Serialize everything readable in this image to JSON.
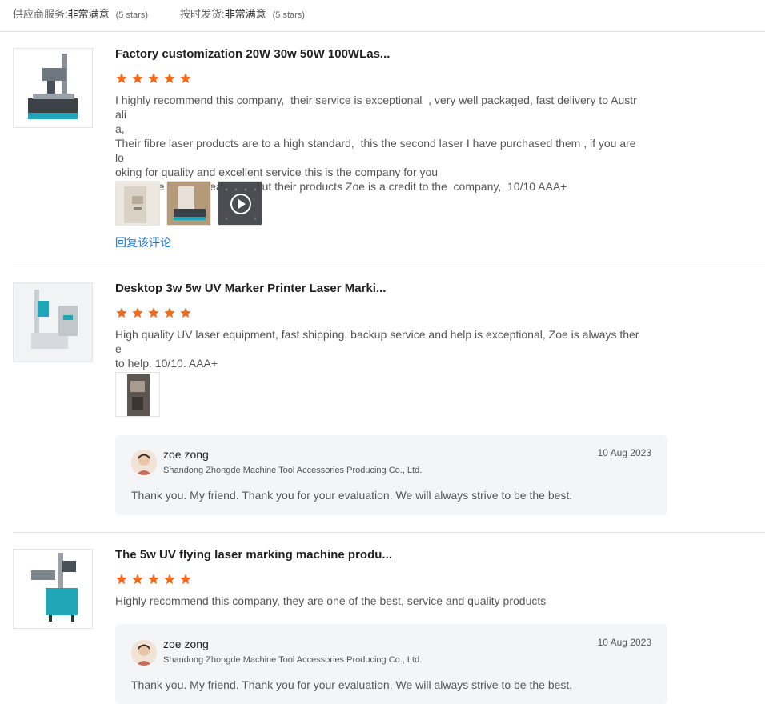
{
  "summary": {
    "supplier_service_label": "供应商服务:",
    "supplier_service_value": "非常满意",
    "supplier_service_stars": "(5 stars)",
    "delivery_label": "按时发货:",
    "delivery_value": "非常满意",
    "delivery_stars": "(5 stars)"
  },
  "colors": {
    "star": "#f56a1a",
    "link": "#1a73c9"
  },
  "reviews": [
    {
      "title": "Factory customization 20W 30w 50W 100WLas...",
      "rating": 5,
      "text": "I highly recommend this company,  their service is exceptional  , very well packaged, fast delivery to Australi\na,\nTheir fibre laser products are to a high standard,  this the second laser I have purchased them , if you are lo\noking for quality and excellent service this is the company for you\nZoe is the girl to speak to about their products Zoe is a credit to the  company,  10/10 AAA+",
      "media_icons": [
        "photo",
        "photo",
        "video-play-icon"
      ],
      "reply_link": "回复该评论"
    },
    {
      "title": "Desktop 3w 5w UV Marker Printer Laser Marki...",
      "rating": 5,
      "text": "High quality UV laser equipment, fast shipping. backup service and help is exceptional, Zoe is always there\nto help. 10/10. AAA+",
      "media_icons": [
        "photo"
      ],
      "supplier_reply": {
        "name": "zoe zong",
        "company": "Shandong Zhongde Machine Tool Accessories Producing Co., Ltd.",
        "date": "10 Aug 2023",
        "text": "Thank you. My friend. Thank you for your evaluation. We will always strive to be the best."
      }
    },
    {
      "title": "The 5w UV flying laser marking machine produ...",
      "rating": 5,
      "text": "Highly recommend this company, they are one of the best, service and quality products",
      "supplier_reply": {
        "name": "zoe zong",
        "company": "Shandong Zhongde Machine Tool Accessories Producing Co., Ltd.",
        "date": "10 Aug 2023",
        "text": "Thank you. My friend. Thank you for your evaluation. We will always strive to be the best."
      }
    }
  ]
}
